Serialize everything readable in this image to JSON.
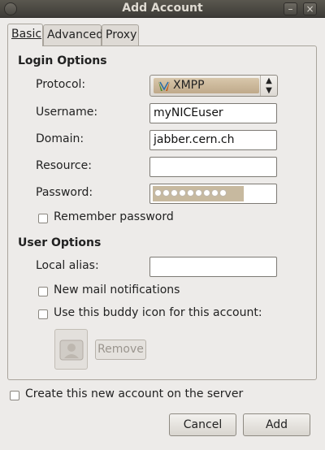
{
  "window": {
    "title": "Add Account"
  },
  "tabs": [
    {
      "label": "Basic"
    },
    {
      "label": "Advanced"
    },
    {
      "label": "Proxy"
    }
  ],
  "login_options": {
    "heading": "Login Options",
    "protocol_label": "Protocol:",
    "protocol_value": "XMPP",
    "username_label": "Username:",
    "username_value": "myNICEuser",
    "domain_label": "Domain:",
    "domain_value": "jabber.cern.ch",
    "resource_label": "Resource:",
    "resource_value": "",
    "password_label": "Password:",
    "password_masked_chars": 9,
    "remember_password_label": "Remember password"
  },
  "user_options": {
    "heading": "User Options",
    "local_alias_label": "Local alias:",
    "local_alias_value": "",
    "new_mail_label": "New mail notifications",
    "buddy_icon_label": "Use this buddy icon for this account:",
    "remove_label": "Remove"
  },
  "footer": {
    "create_account_label": "Create this new account on the server",
    "cancel_label": "Cancel",
    "add_label": "Add"
  },
  "colors": {
    "titlebar": "#3d3b37",
    "window_bg": "#edebe9",
    "password_field_bg": "#c7b99f"
  },
  "icons": {
    "protocol": "xmpp-logo-icon",
    "buddy": "buddy-icon-placeholder"
  }
}
